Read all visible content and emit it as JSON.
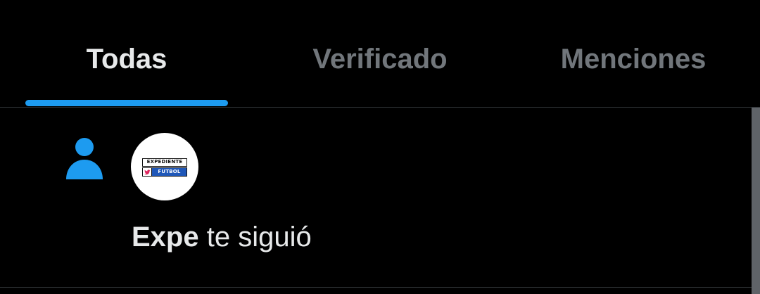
{
  "tabs": [
    {
      "label": "Todas",
      "active": true
    },
    {
      "label": "Verificado",
      "active": false
    },
    {
      "label": "Menciones",
      "active": false
    }
  ],
  "notification": {
    "type_icon": "person-follow-icon",
    "avatar_logo": {
      "top_text": "EXPEDIENTE",
      "bottom_text": "FUTBOL",
      "icon": "twitter-bird-icon"
    },
    "user_name": "Expe",
    "action_text": " te siguió"
  },
  "colors": {
    "accent": "#1d9bf0",
    "text_primary": "#e7e9ea",
    "text_secondary": "#71767b",
    "background": "#000000",
    "divider": "#2f3336"
  }
}
